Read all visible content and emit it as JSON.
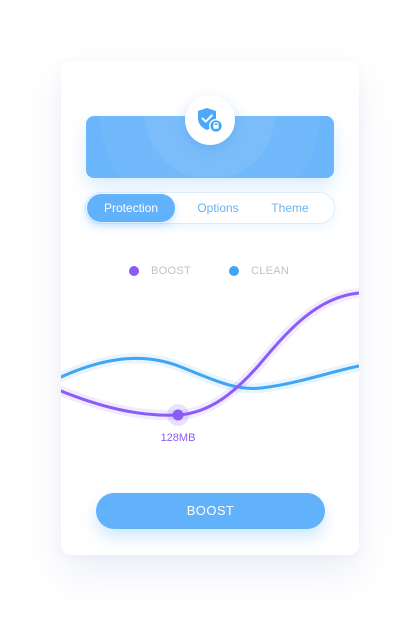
{
  "colors": {
    "accent": "#62b2fb",
    "boost": "#8b5cf6",
    "clean": "#3ea6f5",
    "legend_text": "#bfc3cc"
  },
  "header": {
    "icon": "shield-lock-icon"
  },
  "tabs": [
    {
      "label": "Protection",
      "active": true
    },
    {
      "label": "Options",
      "active": false
    },
    {
      "label": "Theme",
      "active": false
    }
  ],
  "legend": [
    {
      "label": "BOOST",
      "color": "#8b5cf6"
    },
    {
      "label": "CLEAN",
      "color": "#3ea6f5"
    }
  ],
  "chart": {
    "marker_label": "128MB"
  },
  "action": {
    "boost_label": "BOOST"
  }
}
